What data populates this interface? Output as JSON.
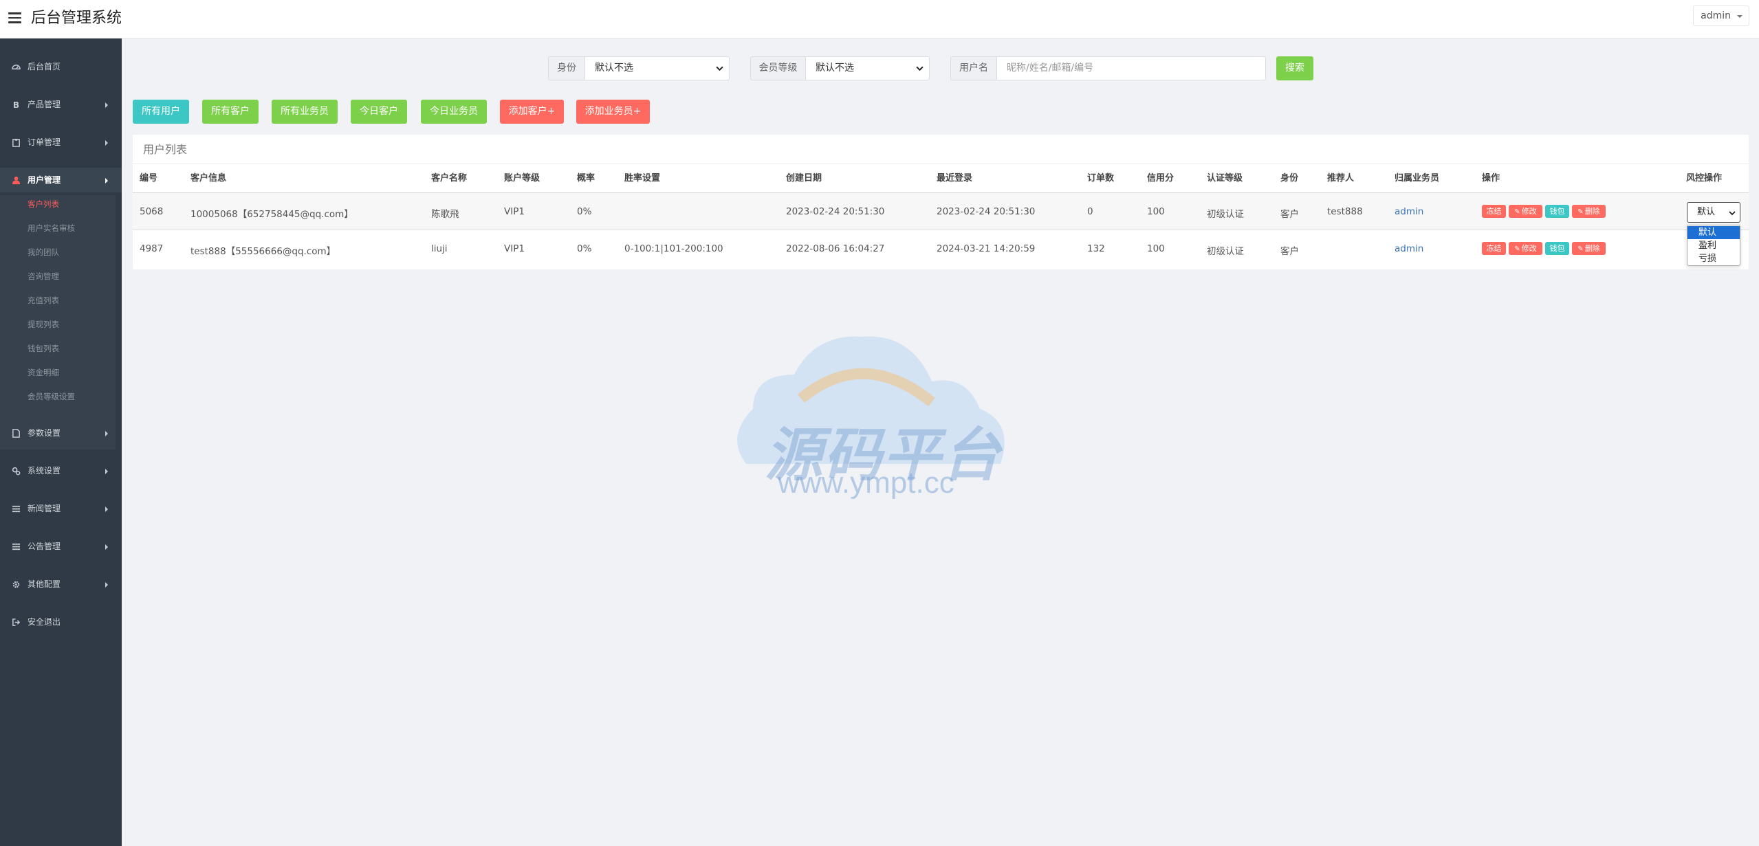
{
  "header": {
    "title": "后台管理系统",
    "user": "admin"
  },
  "sidebar": {
    "items": [
      {
        "label": "后台首页",
        "icon": "dashboard-icon"
      },
      {
        "label": "产品管理",
        "icon": "bitcoin-icon"
      },
      {
        "label": "订单管理",
        "icon": "clipboard-icon"
      },
      {
        "label": "用户管理",
        "icon": "user-icon"
      },
      {
        "label": "参数设置",
        "icon": "file-icon"
      },
      {
        "label": "系统设置",
        "icon": "gears-icon"
      },
      {
        "label": "新闻管理",
        "icon": "list-icon"
      },
      {
        "label": "公告管理",
        "icon": "list-icon"
      },
      {
        "label": "其他配置",
        "icon": "gear-icon"
      },
      {
        "label": "安全退出",
        "icon": "logout-icon"
      }
    ],
    "submenu": [
      "客户列表",
      "用户实名审核",
      "我的团队",
      "咨询管理",
      "充值列表",
      "提现列表",
      "钱包列表",
      "资金明细",
      "会员等级设置"
    ]
  },
  "filters": {
    "identity_label": "身份",
    "identity_value": "默认不选",
    "level_label": "会员等级",
    "level_value": "默认不选",
    "username_label": "用户名",
    "username_placeholder": "昵称/姓名/邮箱/编号",
    "search_label": "搜索"
  },
  "actions": [
    "所有用户",
    "所有客户",
    "所有业务员",
    "今日客户",
    "今日业务员",
    "添加客户+",
    "添加业务员+"
  ],
  "table": {
    "title": "用户列表",
    "headers": [
      "编号",
      "客户信息",
      "客户名称",
      "账户等级",
      "概率",
      "胜率设置",
      "创建日期",
      "最近登录",
      "订单数",
      "信用分",
      "认证等级",
      "身份",
      "推荐人",
      "归属业务员",
      "操作",
      "风控操作"
    ],
    "rows": [
      {
        "id": "5068",
        "info": "10005068【652758445@qq.com】",
        "name": "陈歌飛",
        "level": "VIP1",
        "prob": "0%",
        "winrate": "",
        "created": "2023-02-24 20:51:30",
        "last_login": "2023-02-24 20:51:30",
        "orders": "0",
        "credit": "100",
        "auth": "初级认证",
        "identity": "客户",
        "referrer": "test888",
        "agent": "admin"
      },
      {
        "id": "4987",
        "info": "test888【55556666@qq.com】",
        "name": "liuji",
        "level": "VIP1",
        "prob": "0%",
        "winrate": "0-100:1|101-200:100",
        "created": "2022-08-06 16:04:27",
        "last_login": "2024-03-21 14:20:59",
        "orders": "132",
        "credit": "100",
        "auth": "初级认证",
        "identity": "客户",
        "referrer": "",
        "agent": "admin"
      }
    ],
    "ops": [
      "冻结",
      "修改",
      "钱包",
      "删除"
    ],
    "risk": {
      "value": "默认",
      "options": [
        "默认",
        "盈利",
        "亏损"
      ]
    }
  },
  "watermark": {
    "text": "源码平台",
    "url": "www.ympt.cc"
  },
  "colors": {
    "sidebar": "#2f3a46",
    "green": "#7cd04a",
    "teal": "#3cc6c4",
    "red": "#ff6a60",
    "active_sub": "#ff5a5a"
  }
}
